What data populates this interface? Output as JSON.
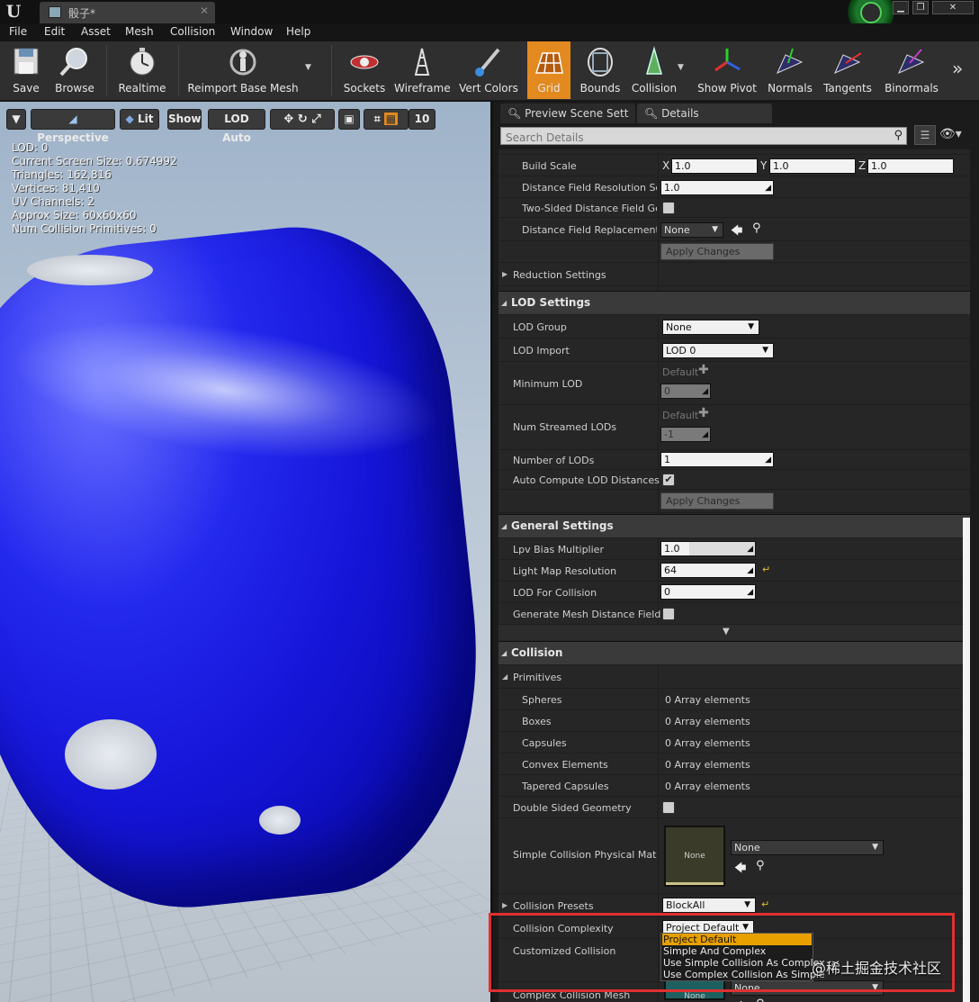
{
  "title_bar": {
    "tab_label": "骰子*"
  },
  "menu": [
    "File",
    "Edit",
    "Asset",
    "Mesh",
    "Collision",
    "Window",
    "Help"
  ],
  "toolbar": [
    {
      "label": "Save",
      "icon": "save-icon"
    },
    {
      "label": "Browse",
      "icon": "browse-icon"
    },
    {
      "label": "Realtime",
      "icon": "realtime-icon"
    },
    {
      "label": "Reimport Base Mesh",
      "icon": "reimport-icon"
    },
    {
      "label": "Sockets",
      "icon": "sockets-icon"
    },
    {
      "label": "Wireframe",
      "icon": "wireframe-icon"
    },
    {
      "label": "Vert Colors",
      "icon": "vert-colors-icon"
    },
    {
      "label": "Grid",
      "icon": "grid-icon",
      "active": true
    },
    {
      "label": "Bounds",
      "icon": "bounds-icon"
    },
    {
      "label": "Collision",
      "icon": "collision-icon"
    },
    {
      "label": "Show Pivot",
      "icon": "pivot-icon"
    },
    {
      "label": "Normals",
      "icon": "normals-icon"
    },
    {
      "label": "Tangents",
      "icon": "tangents-icon"
    },
    {
      "label": "Binormals",
      "icon": "binormals-icon"
    }
  ],
  "viewport": {
    "perspective": "Perspective",
    "lit": "Lit",
    "show": "Show",
    "lod": "LOD Auto",
    "grid_size": "10",
    "stats": [
      "LOD:  0",
      "Current Screen Size:  0.674992",
      "Triangles:  162,816",
      "Vertices:  81,410",
      "UV Channels:  2",
      "Approx Size: 60x60x60",
      "Num Collision Primitives:  0"
    ]
  },
  "panel": {
    "tabs": [
      "Preview Scene Sett",
      "Details"
    ],
    "search_placeholder": "Search Details",
    "build_scale": {
      "label": "Build Scale",
      "x": "1.0",
      "y": "1.0",
      "z": "1.0",
      "axes": [
        "X",
        "Y",
        "Z"
      ]
    },
    "df_resolution": {
      "label": "Distance Field Resolution Sca",
      "value": "1.0"
    },
    "two_sided": {
      "label": "Two-Sided Distance Field Gen"
    },
    "df_replacement": {
      "label": "Distance Field Replacement M",
      "value": "None"
    },
    "apply1": "Apply Changes",
    "reduction": "Reduction Settings",
    "lod_settings": {
      "header": "LOD Settings",
      "lod_group": {
        "label": "LOD Group",
        "value": "None"
      },
      "lod_import": {
        "label": "LOD Import",
        "value": "LOD 0"
      },
      "min_lod": {
        "label": "Minimum LOD",
        "default": "Default",
        "value": "0"
      },
      "num_streamed": {
        "label": "Num Streamed LODs",
        "default": "Default",
        "value": "-1"
      },
      "num_lods": {
        "label": "Number of LODs",
        "value": "1"
      },
      "auto_compute": {
        "label": "Auto Compute LOD Distances"
      },
      "apply": "Apply Changes"
    },
    "general": {
      "header": "General Settings",
      "lpv": {
        "label": "Lpv Bias Multiplier",
        "value": "1.0"
      },
      "lightmap": {
        "label": "Light Map Resolution",
        "value": "64"
      },
      "lod_collision": {
        "label": "LOD For Collision",
        "value": "0"
      },
      "gen_mesh_df": {
        "label": "Generate Mesh Distance Field"
      }
    },
    "collision": {
      "header": "Collision",
      "primitives": "Primitives",
      "items": [
        {
          "label": "Spheres",
          "value": "0 Array elements"
        },
        {
          "label": "Boxes",
          "value": "0 Array elements"
        },
        {
          "label": "Capsules",
          "value": "0 Array elements"
        },
        {
          "label": "Convex Elements",
          "value": "0 Array elements"
        },
        {
          "label": "Tapered Capsules",
          "value": "0 Array elements"
        }
      ],
      "double_sided": "Double Sided Geometry",
      "phys_mat": {
        "label": "Simple Collision Physical Mater",
        "thumb": "None",
        "value": "None"
      },
      "presets": {
        "label": "Collision Presets",
        "value": "BlockAll"
      },
      "complexity": {
        "label": "Collision Complexity",
        "value": "Project Default"
      },
      "customized": "Customized Collision",
      "complex_mesh": {
        "label": "Complex Collision Mesh",
        "thumb": "None",
        "value": "None"
      }
    },
    "popup_options": [
      "Project Default",
      "Simple And Complex",
      "Use Simple Collision As Complex",
      "Use Complex Collision As Simple"
    ]
  },
  "watermark": "@稀土掘金技术社区"
}
